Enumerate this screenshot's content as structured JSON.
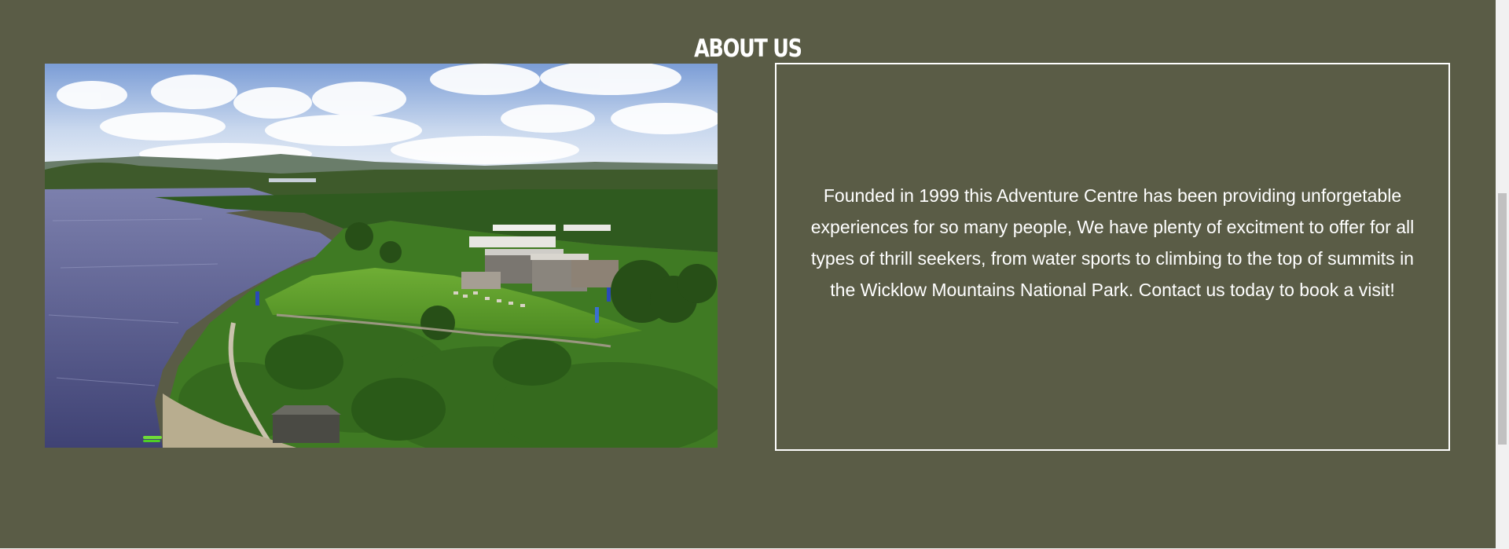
{
  "about": {
    "title": "ABOUT US",
    "photo": {
      "alt_icon": "landscape-photo",
      "description_colors": {
        "sky": "#a9c3e6",
        "lake": "#5b5f90",
        "grass": "#5c9a2c",
        "trees": "#2f5a1f"
      }
    },
    "description": "Founded in 1999 this Adventure Centre has been providing unforgetable experiences for so many people, We have plenty of excitment to offer for all types of thrill seekers, from water sports to climbing to the top of summits in the Wicklow Mountains National Park. Contact us today to book a visit!"
  },
  "theme": {
    "section_background": "#5a5c46",
    "text_color": "#ffffff",
    "border_color": "#ffffff"
  }
}
